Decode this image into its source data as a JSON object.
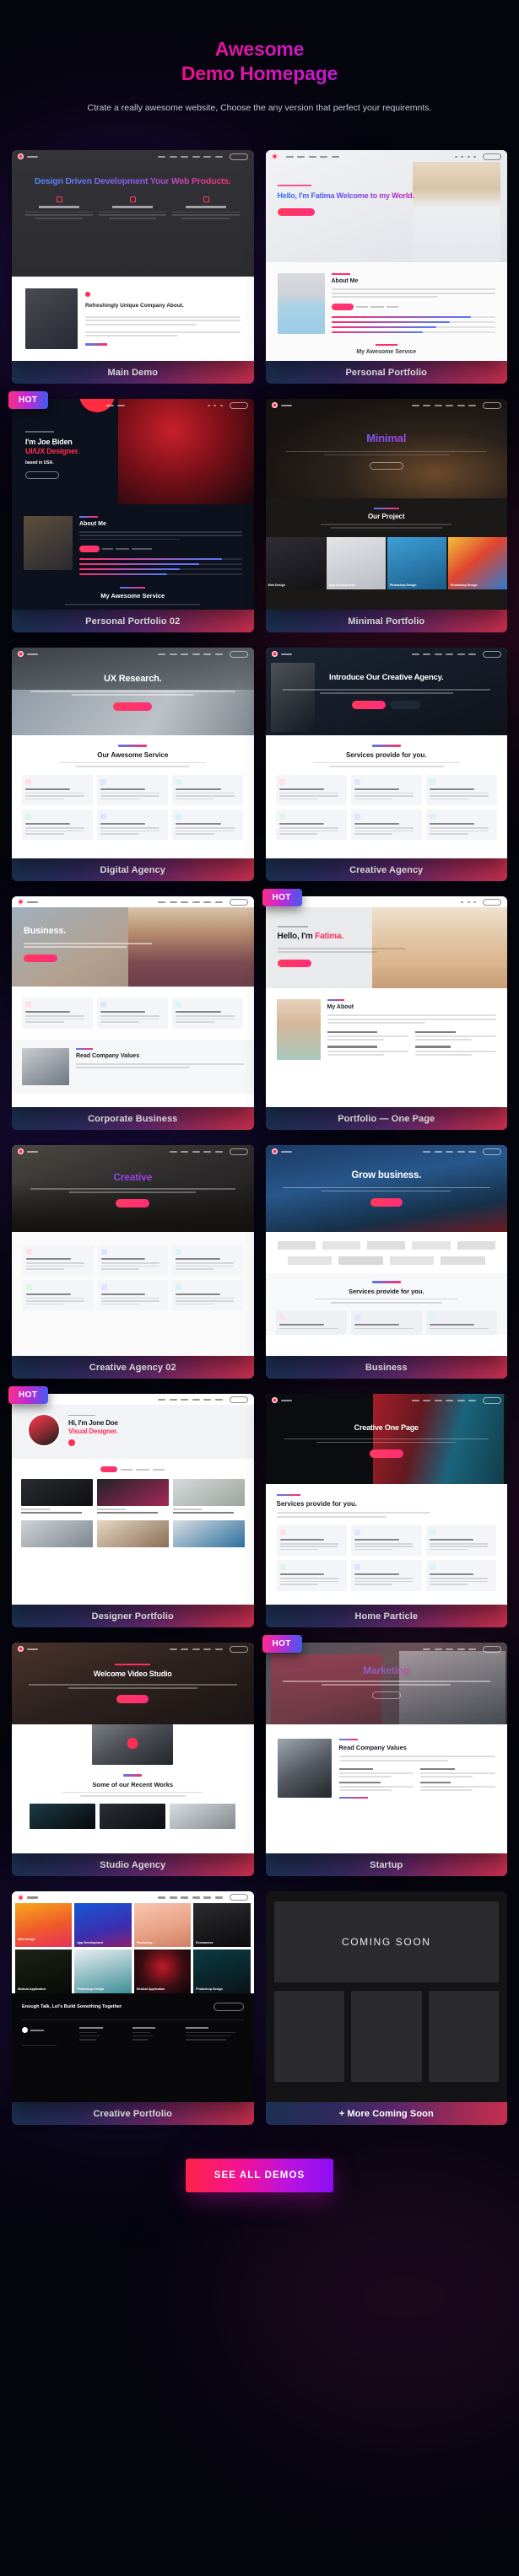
{
  "hero": {
    "title_line1": "Awesome",
    "title_line2": "Demo Homepage",
    "subtitle": "Ctrate a really awesome website, Choose the any version that perfect your requiremnts."
  },
  "cta": {
    "label": "SEE ALL DEMOS"
  },
  "badge_label": "HOT",
  "coming_soon": {
    "text": "COMING SOON"
  },
  "demos": [
    {
      "label": "Main Demo",
      "badge": null,
      "hero_title": "Design Driven Development Your Web Products.",
      "section_title": "Refreshingly Unique Company About."
    },
    {
      "label": "Personal Portfolio",
      "badge": null,
      "hero_title": "Hello, I'm Fatima Welcome to my World.",
      "section_title": "About Me"
    },
    {
      "label": "Personal Portfolio 02",
      "badge": "HOT",
      "hero_title": "I'm Joe Biden",
      "hero_accent": "UI/UX Designer.",
      "hero_sub": "based in USA.",
      "section_title": "About Me",
      "section_title_2": "My Awesome Service"
    },
    {
      "label": "Minimal Portfolio",
      "badge": null,
      "hero_title": "Minimal",
      "section_title": "Our Project",
      "project_labels": [
        "Web Design",
        "App Development",
        "Photoshop Design",
        "Photoshop Design"
      ]
    },
    {
      "label": "Digital Agency",
      "badge": null,
      "hero_title": "UX Research.",
      "section_title": "Our Awesome Service"
    },
    {
      "label": "Creative Agency",
      "badge": null,
      "hero_title": "Introduce Our Creative Agency.",
      "section_title": "Services provide for you."
    },
    {
      "label": "Corporate Business",
      "badge": null,
      "hero_title": "Business.",
      "section_title": "Read Company Values"
    },
    {
      "label": "Portfolio — One Page",
      "badge": "HOT",
      "hero_title": "Hello, I'm",
      "hero_accent": "Fatima.",
      "section_title": "My About"
    },
    {
      "label": "Creative Agency 02",
      "badge": null,
      "hero_title": "Creative",
      "section_title": ""
    },
    {
      "label": "Business",
      "badge": null,
      "hero_title": "Grow business.",
      "section_title": "Services provide for you."
    },
    {
      "label": "Designer Portfolio",
      "badge": "HOT",
      "hero_title": "Hi, I'm Jone Doe",
      "hero_accent": "Visual Designer.",
      "section_title": ""
    },
    {
      "label": "Home Particle",
      "badge": null,
      "hero_title": "Creative One Page",
      "section_title": "Services provide for you."
    },
    {
      "label": "Studio Agency",
      "badge": null,
      "hero_title": "Welcome Video Studio",
      "section_title": "Some of our Recent Works"
    },
    {
      "label": "Startup",
      "badge": "HOT",
      "hero_title": "Marketing",
      "section_title": "Read Company Values"
    },
    {
      "label": "Creative Portfolio",
      "badge": null,
      "hero_title": "",
      "section_title": "Enough Talk, Let's Build Something Together"
    },
    {
      "label": "+ More Coming Soon",
      "badge": null,
      "hero_title": "COMING SOON",
      "section_title": ""
    }
  ]
}
